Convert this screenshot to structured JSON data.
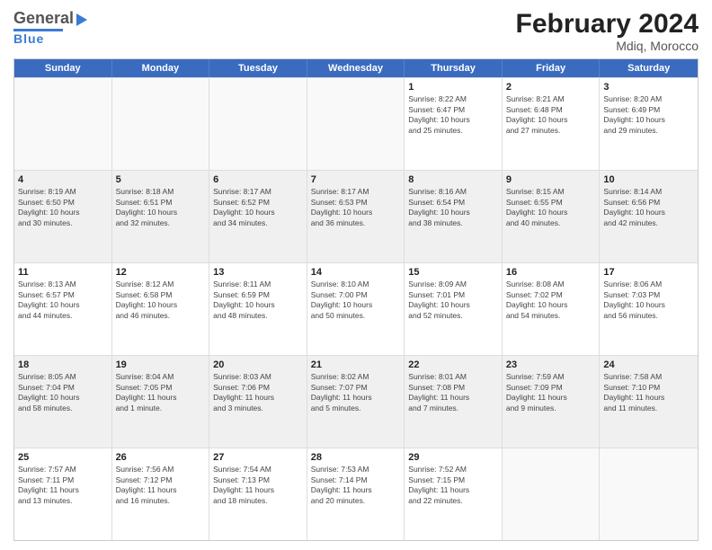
{
  "header": {
    "logo_general": "General",
    "logo_blue": "Blue",
    "main_title": "February 2024",
    "subtitle": "Mdiq, Morocco"
  },
  "weekdays": [
    "Sunday",
    "Monday",
    "Tuesday",
    "Wednesday",
    "Thursday",
    "Friday",
    "Saturday"
  ],
  "rows": [
    [
      {
        "day": "",
        "info": "",
        "empty": true
      },
      {
        "day": "",
        "info": "",
        "empty": true
      },
      {
        "day": "",
        "info": "",
        "empty": true
      },
      {
        "day": "",
        "info": "",
        "empty": true
      },
      {
        "day": "1",
        "info": "Sunrise: 8:22 AM\nSunset: 6:47 PM\nDaylight: 10 hours\nand 25 minutes."
      },
      {
        "day": "2",
        "info": "Sunrise: 8:21 AM\nSunset: 6:48 PM\nDaylight: 10 hours\nand 27 minutes."
      },
      {
        "day": "3",
        "info": "Sunrise: 8:20 AM\nSunset: 6:49 PM\nDaylight: 10 hours\nand 29 minutes."
      }
    ],
    [
      {
        "day": "4",
        "info": "Sunrise: 8:19 AM\nSunset: 6:50 PM\nDaylight: 10 hours\nand 30 minutes.",
        "shaded": true
      },
      {
        "day": "5",
        "info": "Sunrise: 8:18 AM\nSunset: 6:51 PM\nDaylight: 10 hours\nand 32 minutes.",
        "shaded": true
      },
      {
        "day": "6",
        "info": "Sunrise: 8:17 AM\nSunset: 6:52 PM\nDaylight: 10 hours\nand 34 minutes.",
        "shaded": true
      },
      {
        "day": "7",
        "info": "Sunrise: 8:17 AM\nSunset: 6:53 PM\nDaylight: 10 hours\nand 36 minutes.",
        "shaded": true
      },
      {
        "day": "8",
        "info": "Sunrise: 8:16 AM\nSunset: 6:54 PM\nDaylight: 10 hours\nand 38 minutes.",
        "shaded": true
      },
      {
        "day": "9",
        "info": "Sunrise: 8:15 AM\nSunset: 6:55 PM\nDaylight: 10 hours\nand 40 minutes.",
        "shaded": true
      },
      {
        "day": "10",
        "info": "Sunrise: 8:14 AM\nSunset: 6:56 PM\nDaylight: 10 hours\nand 42 minutes.",
        "shaded": true
      }
    ],
    [
      {
        "day": "11",
        "info": "Sunrise: 8:13 AM\nSunset: 6:57 PM\nDaylight: 10 hours\nand 44 minutes."
      },
      {
        "day": "12",
        "info": "Sunrise: 8:12 AM\nSunset: 6:58 PM\nDaylight: 10 hours\nand 46 minutes."
      },
      {
        "day": "13",
        "info": "Sunrise: 8:11 AM\nSunset: 6:59 PM\nDaylight: 10 hours\nand 48 minutes."
      },
      {
        "day": "14",
        "info": "Sunrise: 8:10 AM\nSunset: 7:00 PM\nDaylight: 10 hours\nand 50 minutes."
      },
      {
        "day": "15",
        "info": "Sunrise: 8:09 AM\nSunset: 7:01 PM\nDaylight: 10 hours\nand 52 minutes."
      },
      {
        "day": "16",
        "info": "Sunrise: 8:08 AM\nSunset: 7:02 PM\nDaylight: 10 hours\nand 54 minutes."
      },
      {
        "day": "17",
        "info": "Sunrise: 8:06 AM\nSunset: 7:03 PM\nDaylight: 10 hours\nand 56 minutes."
      }
    ],
    [
      {
        "day": "18",
        "info": "Sunrise: 8:05 AM\nSunset: 7:04 PM\nDaylight: 10 hours\nand 58 minutes.",
        "shaded": true
      },
      {
        "day": "19",
        "info": "Sunrise: 8:04 AM\nSunset: 7:05 PM\nDaylight: 11 hours\nand 1 minute.",
        "shaded": true
      },
      {
        "day": "20",
        "info": "Sunrise: 8:03 AM\nSunset: 7:06 PM\nDaylight: 11 hours\nand 3 minutes.",
        "shaded": true
      },
      {
        "day": "21",
        "info": "Sunrise: 8:02 AM\nSunset: 7:07 PM\nDaylight: 11 hours\nand 5 minutes.",
        "shaded": true
      },
      {
        "day": "22",
        "info": "Sunrise: 8:01 AM\nSunset: 7:08 PM\nDaylight: 11 hours\nand 7 minutes.",
        "shaded": true
      },
      {
        "day": "23",
        "info": "Sunrise: 7:59 AM\nSunset: 7:09 PM\nDaylight: 11 hours\nand 9 minutes.",
        "shaded": true
      },
      {
        "day": "24",
        "info": "Sunrise: 7:58 AM\nSunset: 7:10 PM\nDaylight: 11 hours\nand 11 minutes.",
        "shaded": true
      }
    ],
    [
      {
        "day": "25",
        "info": "Sunrise: 7:57 AM\nSunset: 7:11 PM\nDaylight: 11 hours\nand 13 minutes."
      },
      {
        "day": "26",
        "info": "Sunrise: 7:56 AM\nSunset: 7:12 PM\nDaylight: 11 hours\nand 16 minutes."
      },
      {
        "day": "27",
        "info": "Sunrise: 7:54 AM\nSunset: 7:13 PM\nDaylight: 11 hours\nand 18 minutes."
      },
      {
        "day": "28",
        "info": "Sunrise: 7:53 AM\nSunset: 7:14 PM\nDaylight: 11 hours\nand 20 minutes."
      },
      {
        "day": "29",
        "info": "Sunrise: 7:52 AM\nSunset: 7:15 PM\nDaylight: 11 hours\nand 22 minutes."
      },
      {
        "day": "",
        "info": "",
        "empty": true
      },
      {
        "day": "",
        "info": "",
        "empty": true
      }
    ]
  ]
}
